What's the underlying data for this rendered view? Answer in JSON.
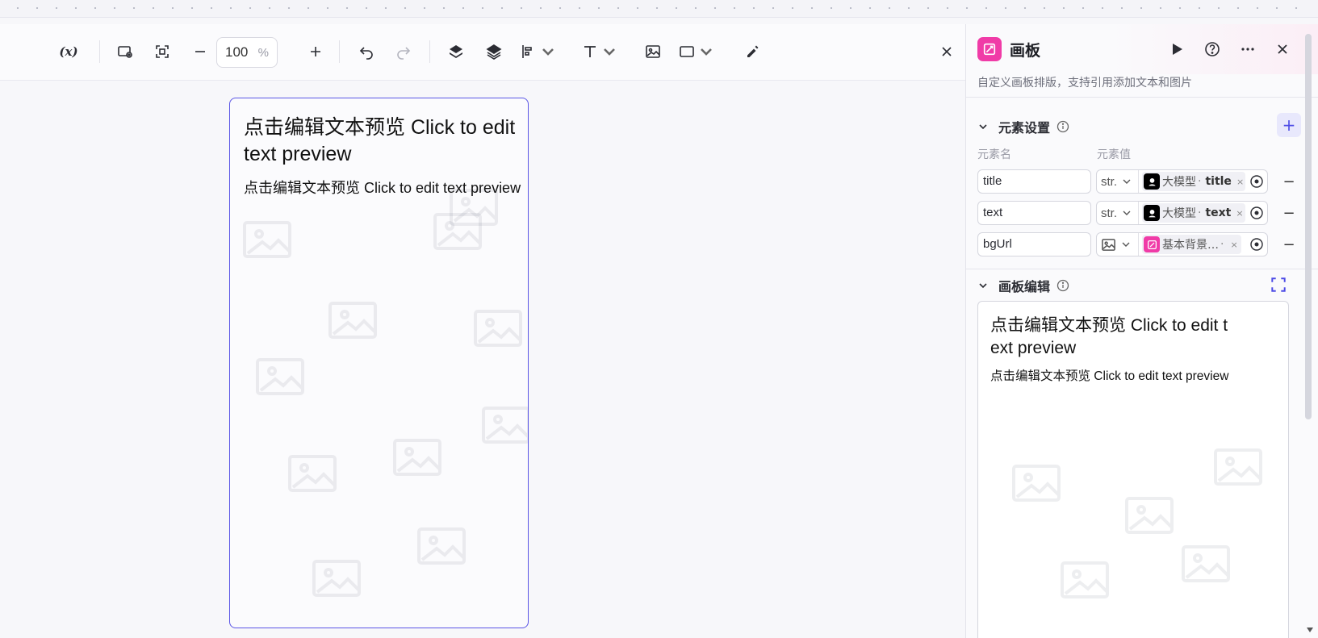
{
  "toolbar": {
    "variables_label": "(x)",
    "zoom_value": "100",
    "zoom_unit": "%"
  },
  "artboard": {
    "label": "画板",
    "title": "点击编辑文本预览 Click to edit  text preview",
    "text": "点击编辑文本预览 Click to edit text preview"
  },
  "panel": {
    "title": "画板",
    "description": "自定义画板排版，支持引用添加文本和图片",
    "element_section": {
      "title": "元素设置",
      "col_name": "元素名",
      "col_value": "元素值",
      "add_label": "+",
      "rows": [
        {
          "name": "title",
          "type": "str.",
          "source": "大模型",
          "sep": "·",
          "field": "title",
          "icon": "llm-icon",
          "remove": "×",
          "delete": "−"
        },
        {
          "name": "text",
          "type": "str.",
          "source": "大模型",
          "sep": "·",
          "field": "text",
          "icon": "llm-icon",
          "remove": "×",
          "delete": "−"
        },
        {
          "name": "bgUrl",
          "type": "image",
          "source": "基本背景…",
          "sep": "·",
          "field": "",
          "icon": "canvas-icon",
          "remove": "×",
          "delete": "−"
        }
      ]
    },
    "canvas_section": {
      "title": "画板编辑",
      "preview_title": "点击编辑文本预览 Click to edit  text preview",
      "preview_text": "点击编辑文本预览 Click to edit text preview"
    }
  },
  "colors": {
    "accent": "#5b56e6",
    "brand_pink": "#f03ba7",
    "llm_icon_bg": "#000000"
  }
}
